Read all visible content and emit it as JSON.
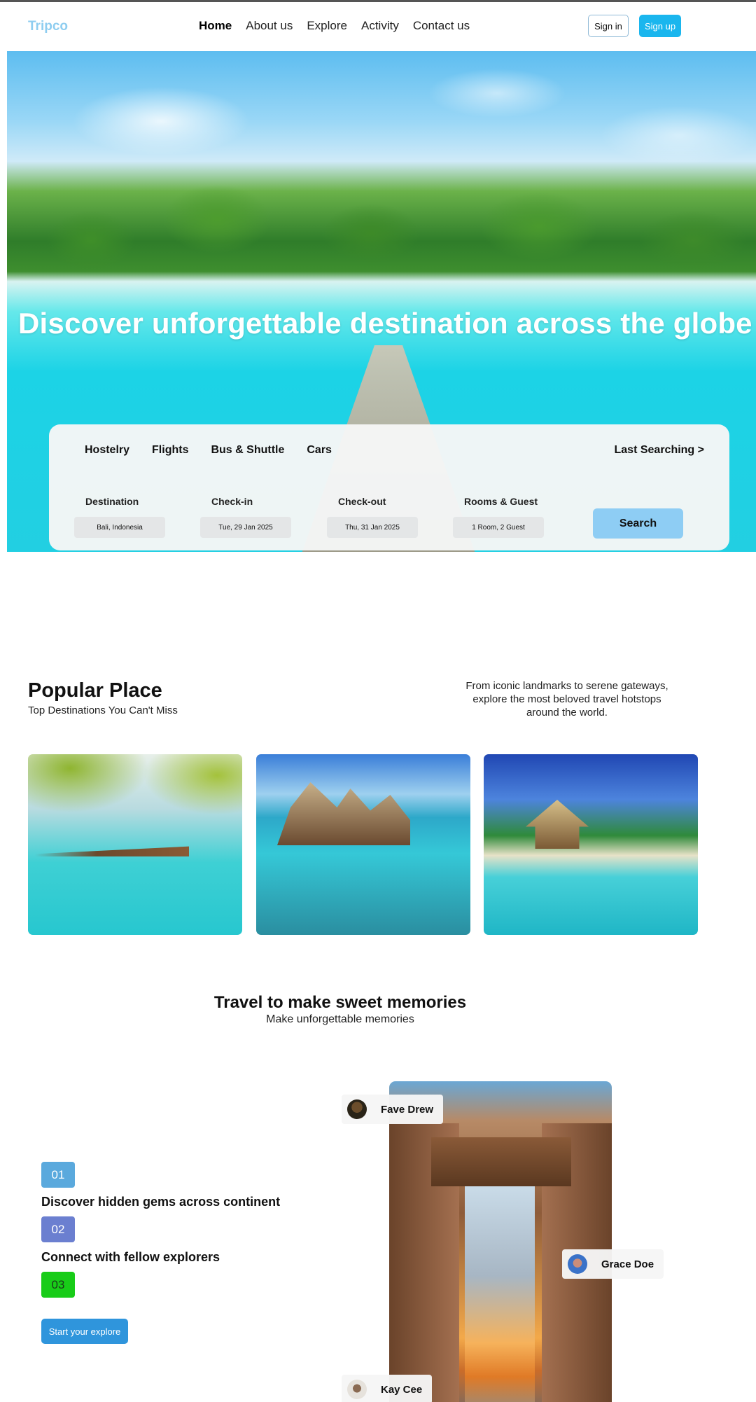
{
  "navbar": {
    "logo": "Tripco",
    "links": [
      "Home",
      "About us",
      "Explore",
      "Activity",
      "Contact us"
    ],
    "active_link": "Home",
    "signin_label": "Sign in",
    "signup_label": "Sign up"
  },
  "hero": {
    "title": "Discover unforgettable destination across the globe"
  },
  "search": {
    "tabs": [
      "Hostelry",
      "Flights",
      "Bus & Shuttle",
      "Cars"
    ],
    "last_searching": "Last Searching >",
    "fields": [
      {
        "label": "Destination",
        "value": "Bali, Indonesia"
      },
      {
        "label": "Check-in",
        "value": "Tue, 29 Jan 2025"
      },
      {
        "label": "Check-out",
        "value": "Thu, 31 Jan 2025"
      },
      {
        "label": "Rooms & Guest",
        "value": "1 Room, 2 Guest"
      }
    ],
    "search_label": "Search"
  },
  "popular": {
    "title": "Popular Place",
    "subtitle": "Top Destinations You Can't Miss",
    "description": "From iconic landmarks to serene gateways, explore the most beloved travel hotstops around the world."
  },
  "memories": {
    "title": "Travel to make sweet memories",
    "subtitle": "Make unforgettable memories",
    "steps": [
      {
        "number": "01",
        "text": "Discover hidden gems across continent",
        "color": "#5aa9dd"
      },
      {
        "number": "02",
        "text": "Connect with fellow explorers",
        "color": "#6b7fd0"
      },
      {
        "number": "03",
        "text": "",
        "color": "#18cc18"
      }
    ],
    "cta_label": "Start your explore",
    "people": [
      "Fave Drew",
      "Grace Doe",
      "Kay Cee"
    ]
  },
  "colors": {
    "accent": "#1ab6ee",
    "logo": "#8ecdf0",
    "search_button": "#8ecdf4",
    "cta": "#2f95dc"
  }
}
